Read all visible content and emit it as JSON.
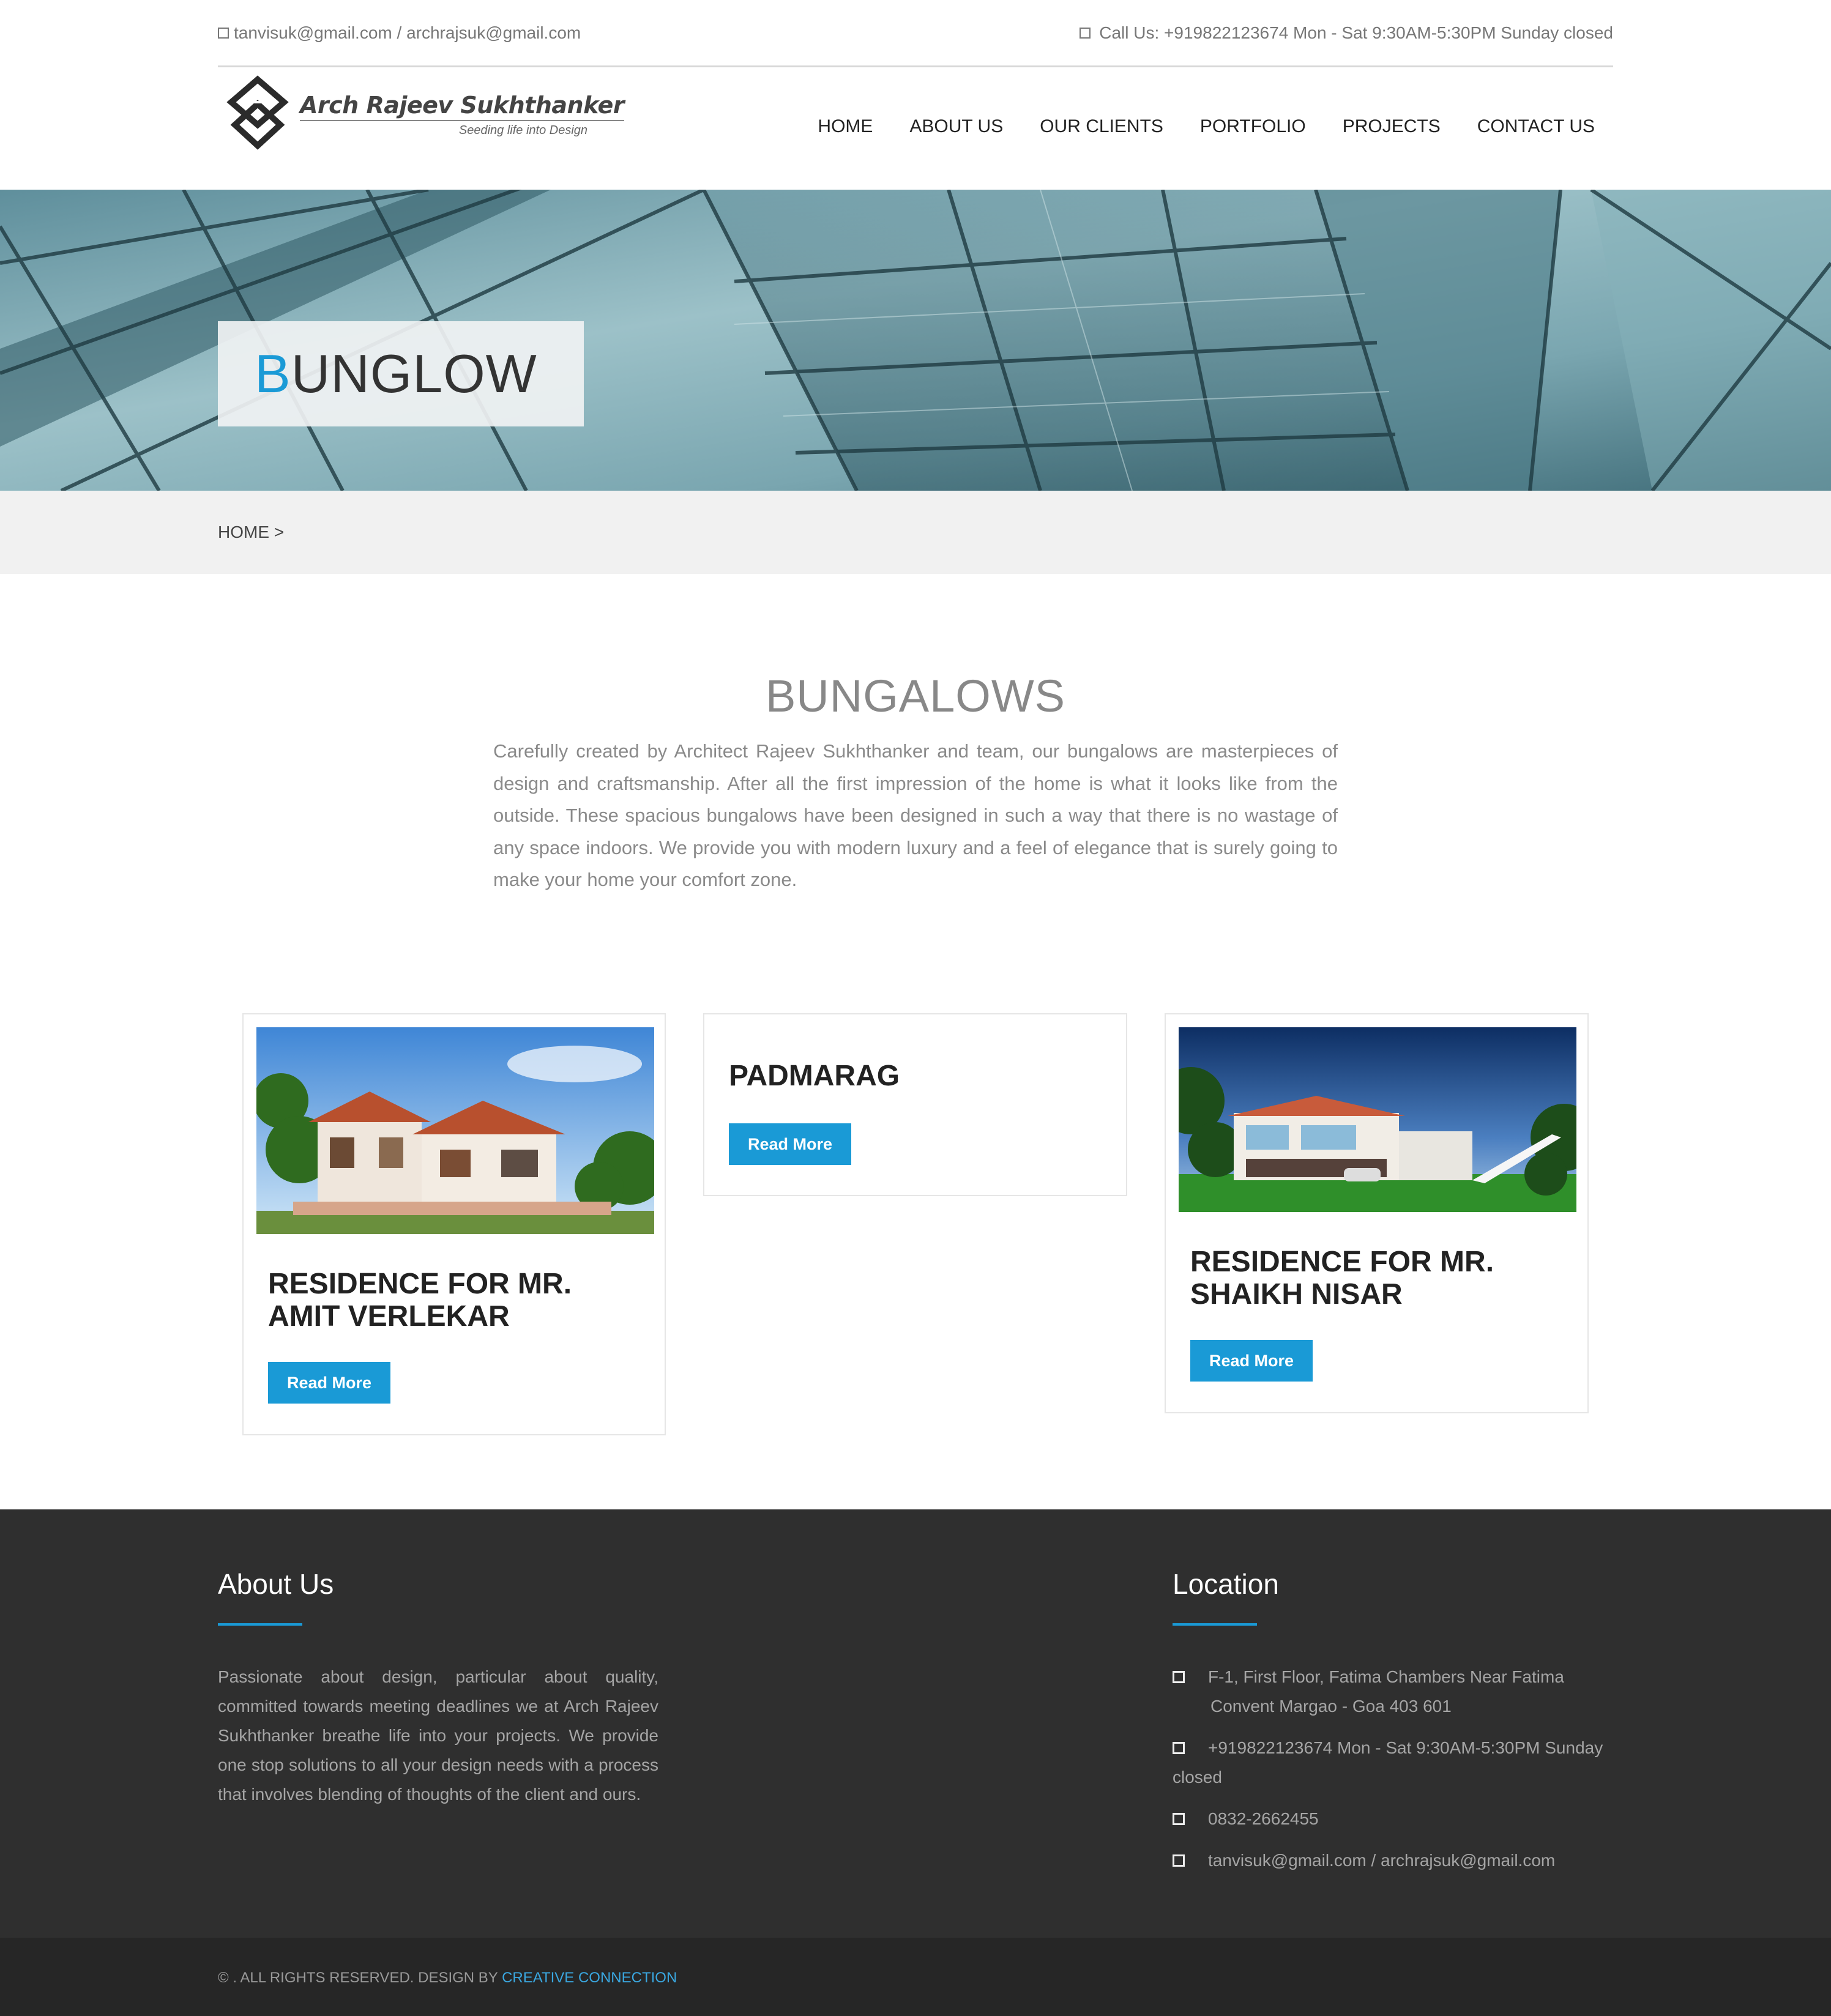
{
  "topbar": {
    "emails": "tanvisuk@gmail.com / archrajsuk@gmail.com",
    "call": "Call Us: +919822123674 Mon - Sat 9:30AM-5:30PM Sunday closed"
  },
  "logo": {
    "title": "Arch Rajeev Sukhthanker",
    "tagline": "Seeding life into Design"
  },
  "nav": [
    "HOME",
    "ABOUT US",
    "OUR CLIENTS",
    "PORTFOLIO",
    "PROJECTS",
    "CONTACT US"
  ],
  "hero": {
    "title_first": "B",
    "title_rest": "UNGLOW"
  },
  "breadcrumb": "HOME >",
  "section": {
    "title": "BUNGALOWS",
    "intro": "Carefully created by Architect Rajeev Sukhthanker and team, our bungalows are masterpieces of design and craftsmanship. After all the first impression of the home is what it looks like from the outside. These spacious bungalows have been designed in such a way that there is no wastage of any space indoors. We provide you with modern luxury and a feel of elegance that is surely going to make your home your comfort zone."
  },
  "cards": [
    {
      "title": "RESIDENCE FOR MR. AMIT VERLEKAR",
      "button": "Read More"
    },
    {
      "title": "PADMARAG",
      "button": "Read More"
    },
    {
      "title": "RESIDENCE FOR MR. SHAIKH NISAR",
      "button": "Read More"
    }
  ],
  "footer": {
    "about_heading": "About Us",
    "about_text": "Passionate about design, particular about quality, committed towards meeting deadlines we at Arch Rajeev Sukhthanker breathe life into your projects. We provide one stop solutions to all your design needs with a process that involves blending of thoughts of the client and ours.",
    "location_heading": "Location",
    "address_line1": "F-1, First Floor, Fatima Chambers Near Fatima",
    "address_line2": "Convent Margao - Goa 403 601",
    "hours_line1": "+919822123674 Mon - Sat 9:30AM-5:30PM Sunday",
    "hours_line2": "closed",
    "phone": "0832-2662455",
    "emails": "tanvisuk@gmail.com / archrajsuk@gmail.com"
  },
  "copyright": {
    "text": "© . ALL RIGHTS RESERVED. DESIGN BY ",
    "link": "CREATIVE CONNECTION"
  },
  "colors": {
    "accent": "#1a9ad6",
    "footer": "#2f2f2f",
    "footer_bottom": "#262626"
  }
}
